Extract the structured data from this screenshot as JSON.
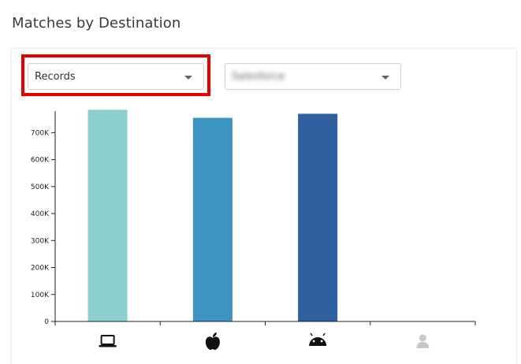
{
  "page": {
    "title": "Matches by Destination"
  },
  "filters": {
    "metric_selected": "Records",
    "source_selected": "Salesforce"
  },
  "chart_data": {
    "type": "bar",
    "categories": [
      "desktop",
      "apple",
      "android",
      "person"
    ],
    "category_icons": [
      "laptop-icon",
      "apple-icon",
      "android-icon",
      "person-icon"
    ],
    "values": [
      785000,
      755000,
      770000,
      0
    ],
    "colors": [
      "#8ccfcf",
      "#3d93c1",
      "#2e5f9e",
      "#cccccc"
    ],
    "ylim": [
      0,
      780000
    ],
    "yticks": [
      0,
      100000,
      200000,
      300000,
      400000,
      500000,
      600000,
      700000
    ],
    "ytick_labels": [
      "0",
      "100K",
      "200K",
      "300K",
      "400K",
      "500K",
      "600K",
      "700K"
    ],
    "title": "",
    "xlabel": "",
    "ylabel": ""
  }
}
